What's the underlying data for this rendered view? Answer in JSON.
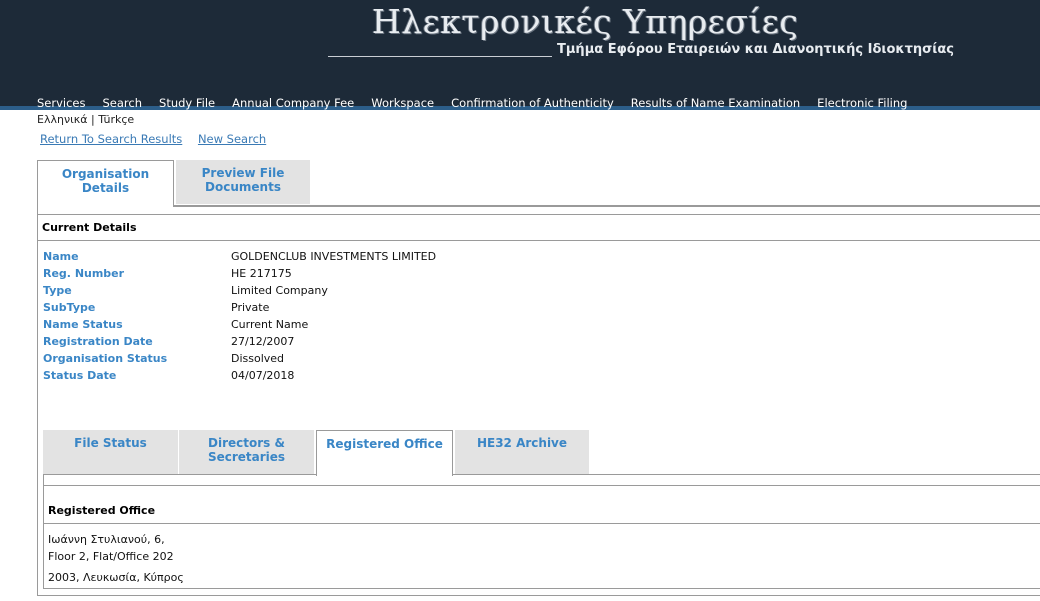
{
  "header": {
    "title": "Ηλεκτρονικές Υπηρεσίες",
    "subtitle": "Τμήμα Εφόρου Εταιρειών και Διανοητικής Ιδιοκτησίας"
  },
  "nav": {
    "items": [
      "Services",
      "Search",
      "Study File",
      "Annual Company Fee",
      "Workspace",
      "Confirmation of Authenticity",
      "Results of Name Examination",
      "Electronic Filing"
    ]
  },
  "lang": {
    "greek": "Ελληνικά",
    "sep": "|",
    "turkish": "Türkçe"
  },
  "links": {
    "return": "Return To Search Results",
    "new_search": "New Search"
  },
  "top_tabs": {
    "org": "Organisation Details",
    "preview_line1": "Preview File",
    "preview_line2": "Documents"
  },
  "current": {
    "title": "Current Details",
    "rows": [
      {
        "label": "Name",
        "value": "GOLDENCLUB INVESTMENTS LIMITED"
      },
      {
        "label": "Reg. Number",
        "value": "HE 217175"
      },
      {
        "label": "Type",
        "value": "Limited Company"
      },
      {
        "label": "SubType",
        "value": "Private"
      },
      {
        "label": "Name Status",
        "value": "Current Name"
      },
      {
        "label": "Registration Date",
        "value": "27/12/2007"
      },
      {
        "label": "Organisation Status",
        "value": "Dissolved"
      },
      {
        "label": "Status Date",
        "value": "04/07/2018"
      }
    ]
  },
  "sub_tabs": {
    "file_status": "File Status",
    "directors": "Directors & Secretaries",
    "registered_office": "Registered Office",
    "he32": "HE32 Archive"
  },
  "office": {
    "title": "Registered Office",
    "line1": "Ιωάννη Στυλιανού, 6,",
    "line2": "Floor 2, Flat/Office 202",
    "line3": "2003, Λευκωσία, Κύπρος"
  }
}
